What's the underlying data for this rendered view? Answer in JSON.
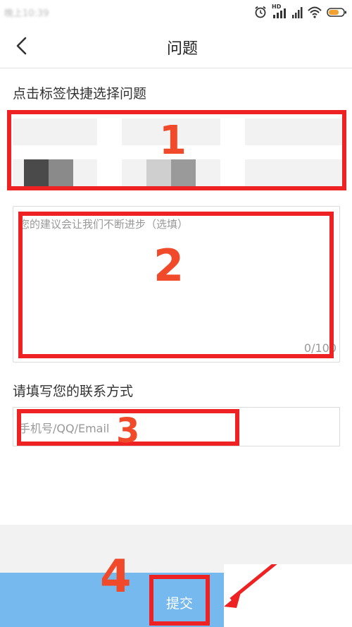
{
  "status_bar": {
    "time": "晚上10:39",
    "icons": [
      "alarm-icon",
      "hd-icon",
      "signal-icon",
      "wifi-icon",
      "battery-icon"
    ],
    "hd_label": "HD"
  },
  "nav": {
    "back_icon": "chevron-left-icon",
    "title": "问题"
  },
  "quick_select": {
    "label": "点击标签快捷选择问题"
  },
  "feedback": {
    "placeholder": "您的建议会让我们不断进步（选填）",
    "counter": "0/100"
  },
  "contact": {
    "label": "请填写您的联系方式",
    "placeholder": "手机号/QQ/Email"
  },
  "submit": {
    "label": "提交"
  },
  "annotations": {
    "step1": "1",
    "step2": "2",
    "step3": "3",
    "step4": "4"
  },
  "colors": {
    "highlight_red": "#ee2222",
    "number_orange": "#f04a2a",
    "submit_blue": "#75b9ee"
  }
}
